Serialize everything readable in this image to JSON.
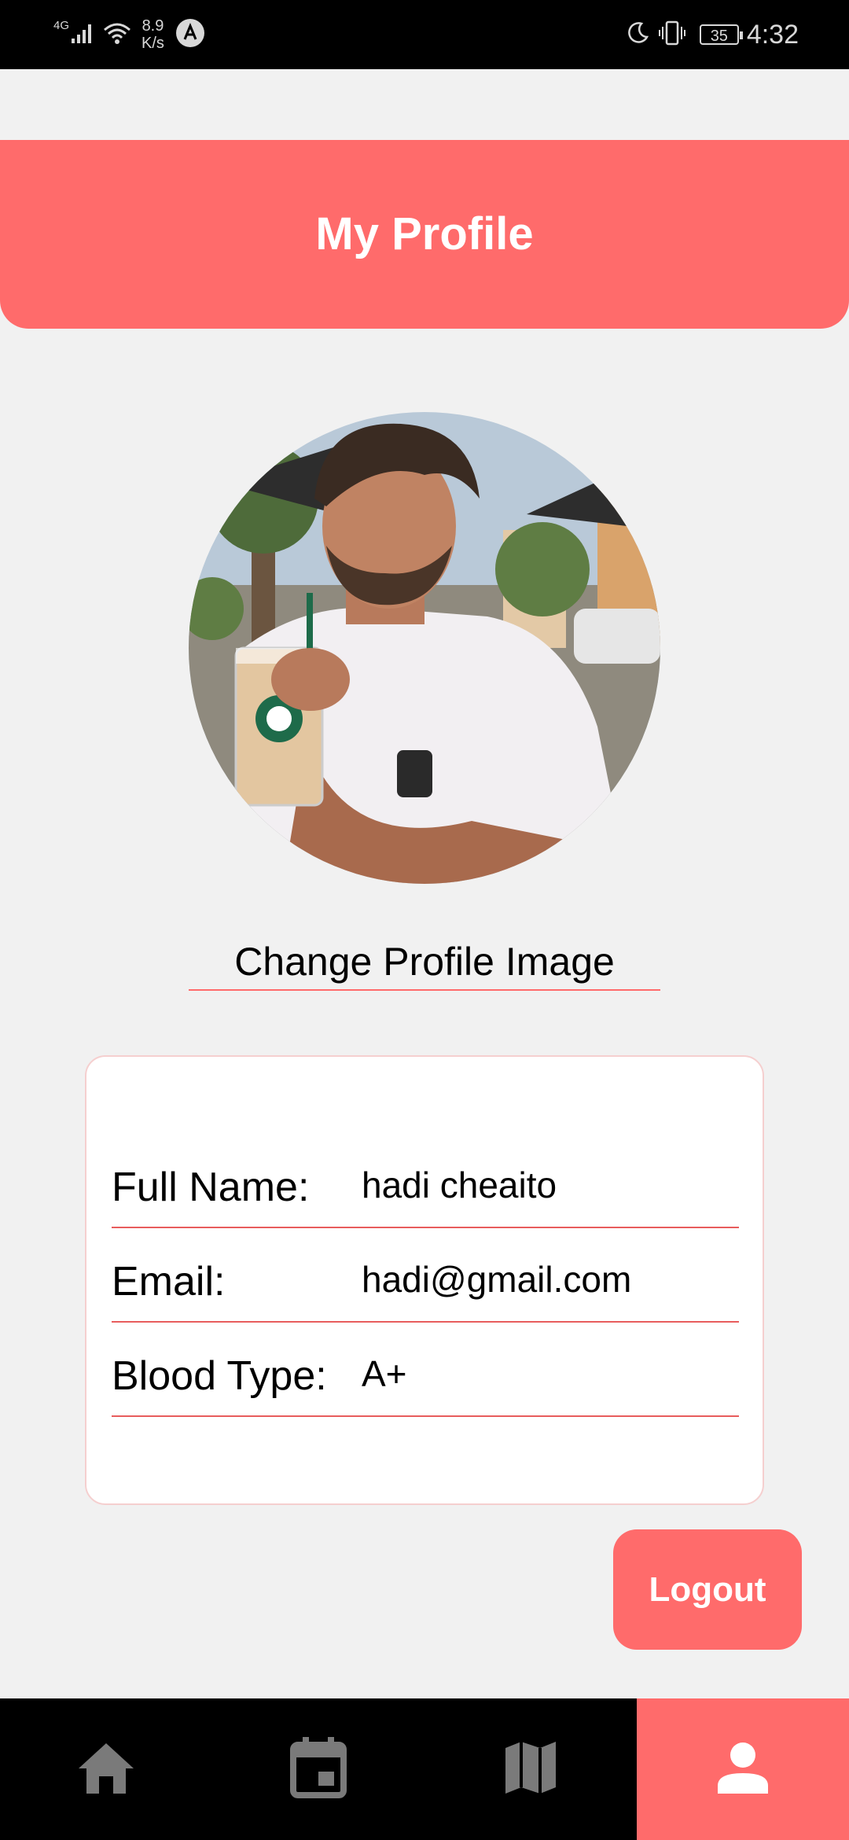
{
  "status_bar": {
    "network": "4G",
    "speed_value": "8.9",
    "speed_unit": "K/s",
    "battery": "35",
    "time": "4:32",
    "icons": [
      "signal-icon",
      "wifi-icon",
      "app-notification-icon",
      "moon-icon",
      "vibrate-icon",
      "battery-icon"
    ]
  },
  "header": {
    "title": "My Profile"
  },
  "profile": {
    "avatar_icon": "profile-photo",
    "change_image_label": "Change Profile Image"
  },
  "info": {
    "full_name_label": "Full Name:",
    "full_name_value": "hadi cheaito",
    "email_label": "Email:",
    "email_value": "hadi@gmail.com",
    "blood_type_label": "Blood Type:",
    "blood_type_value": "A+"
  },
  "logout_label": "Logout",
  "bottom_nav": {
    "items": [
      "home-icon",
      "calendar-icon",
      "map-icon",
      "person-icon"
    ],
    "active": "person-icon"
  },
  "colors": {
    "accent": "#ff6b6b",
    "background": "#f1f1f1",
    "nav_background": "#000000",
    "inactive_icon": "#7a7a7a"
  }
}
